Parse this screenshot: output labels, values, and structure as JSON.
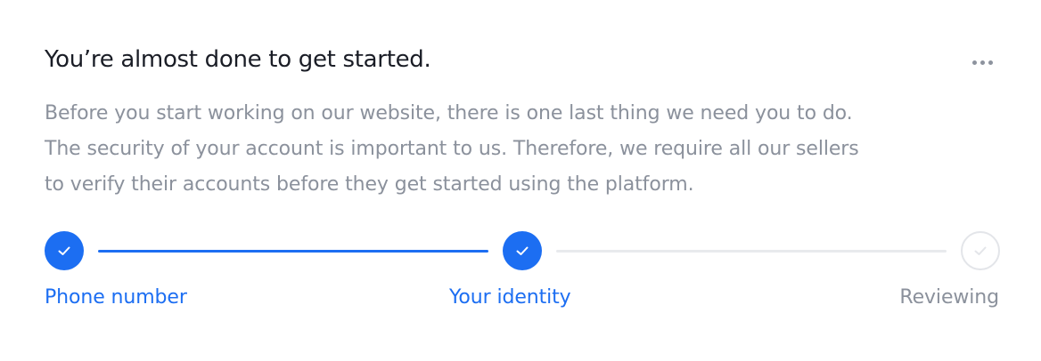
{
  "card": {
    "title": "You’re almost done to get started.",
    "more_icon": "more-horizontal-icon",
    "description_lines": [
      "Before you start working on our website, there is one last thing we need you to do.",
      "The security of your account is important to us. Therefore, we require all our sellers",
      "to verify their accounts before they get started using the platform."
    ]
  },
  "stepper": {
    "accent_color": "#1c6ef2",
    "inactive_color": "#8b919c",
    "steps": [
      {
        "label": "Phone number",
        "status": "completed",
        "icon": "check-icon"
      },
      {
        "label": "Your identity",
        "status": "completed",
        "icon": "check-icon"
      },
      {
        "label": "Reviewing",
        "status": "pending",
        "icon": "check-icon"
      }
    ]
  }
}
